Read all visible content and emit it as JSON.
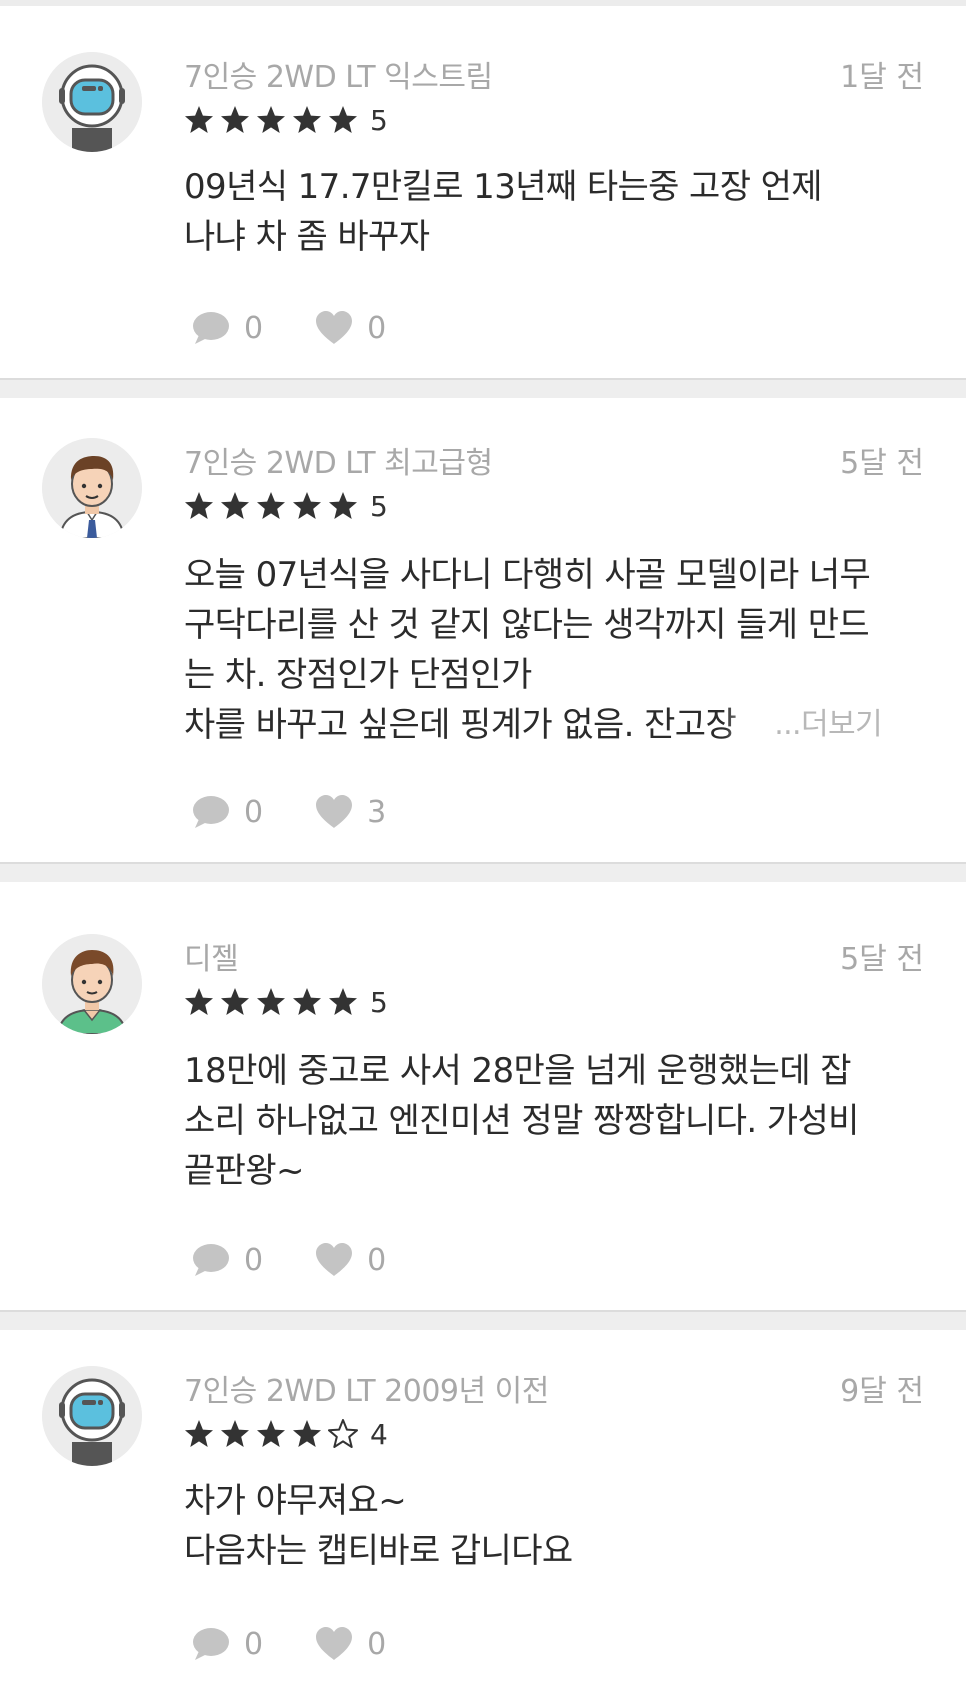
{
  "reviews": [
    {
      "avatar_icon": "astronaut-avatar-icon",
      "trim": "7인승 2WD LT 익스트림",
      "time": "1달 전",
      "stars": 5,
      "score": "5",
      "lines": [
        "09년식 17.7만킬로    13년째 타는중   고장 언제",
        "나냐  차 좀 바꾸자"
      ],
      "comments": "0",
      "likes": "0"
    },
    {
      "avatar_icon": "man-tie-avatar-icon",
      "trim": "7인승 2WD LT 최고급형",
      "time": "5달 전",
      "stars": 5,
      "score": "5",
      "lines": [
        "오늘 07년식을 사다니 다행히 사골 모델이라 너무",
        "구닥다리를 산 것 같지 않다는 생각까지 들게 만드",
        "는 차. 장점인가 단점인가",
        "차를 바꾸고 싶은데 핑계가 없음. 잔고장"
      ],
      "more_label": "...더보기",
      "comments": "0",
      "likes": "3"
    },
    {
      "avatar_icon": "man-green-shirt-avatar-icon",
      "trim": "디젤",
      "time": "5달 전",
      "stars": 5,
      "score": "5",
      "lines": [
        "18만에 중고로 사서 28만을 넘게 운행했는데 잡",
        "소리 하나없고 엔진미션 정말 짱짱합니다. 가성비",
        "끝판왕~"
      ],
      "comments": "0",
      "likes": "0"
    },
    {
      "avatar_icon": "astronaut-avatar-icon",
      "trim": "7인승 2WD LT 2009년 이전",
      "time": "9달 전",
      "stars": 4,
      "score": "4",
      "lines": [
        "차가 야무져요~",
        "다음차는 캡티바로 갑니다요"
      ],
      "comments": "0",
      "likes": "0"
    }
  ],
  "colors": {
    "muted_text": "#a8a8a8",
    "body_text": "#2b2b2b",
    "star_fill": "#333333",
    "icon_gray": "#c4c4c4",
    "divider": "#eeeeee"
  }
}
